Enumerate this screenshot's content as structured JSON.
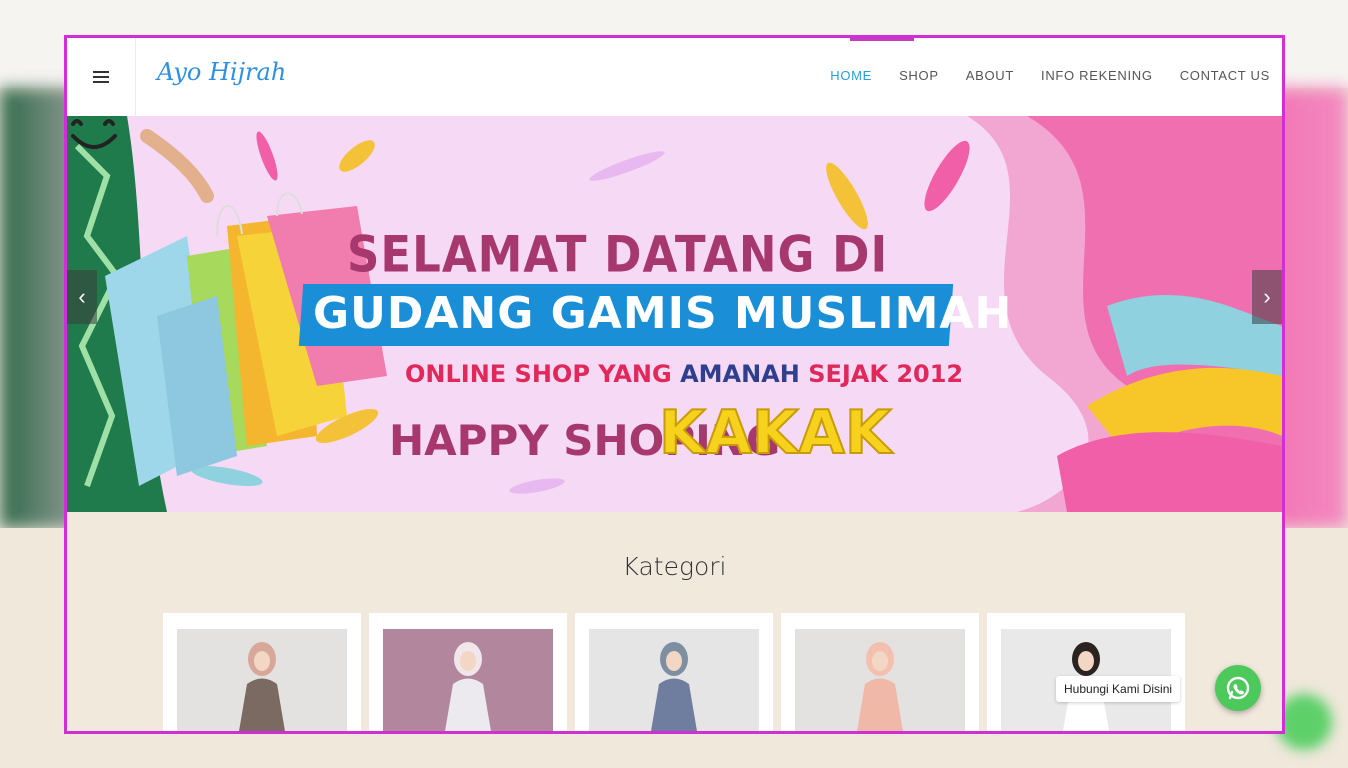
{
  "brand": {
    "name": "Ayo Hijrah"
  },
  "nav": {
    "items": [
      {
        "label": "HOME",
        "active": true
      },
      {
        "label": "SHOP",
        "active": false
      },
      {
        "label": "ABOUT",
        "active": false
      },
      {
        "label": "INFO REKENING",
        "active": false
      },
      {
        "label": "CONTACT US",
        "active": false
      }
    ]
  },
  "hero": {
    "line1": "SELAMAT DATANG DI",
    "line2": "GUDANG GAMIS MUSLIMAH",
    "line3_a": "ONLINE SHOP YANG ",
    "line3_b": "AMANAH",
    "line3_c": " SEJAK 2012",
    "line4": "HAPPY SHOPING",
    "line4_accent": "KAKAK",
    "prev_icon": "chevron-left-icon",
    "next_icon": "chevron-right-icon"
  },
  "kategori": {
    "title": "Kategori",
    "cards": [
      {
        "name": "category-1",
        "bg": "#e4e2e1",
        "garment": "#7a6a62",
        "hijab": "#d7a89a"
      },
      {
        "name": "category-2",
        "bg": "#b2869d",
        "garment": "#ece9ef",
        "hijab": "#f1e6e9"
      },
      {
        "name": "category-3",
        "bg": "#e5e5e5",
        "garment": "#6f7e9e",
        "hijab": "#7f8fa2"
      },
      {
        "name": "category-4",
        "bg": "#e4e2e1",
        "garment": "#f0b8a6",
        "hijab": "#f3bfae"
      },
      {
        "name": "category-5",
        "bg": "#e9e9e9",
        "garment": "#ffffff",
        "hijab": "#2a2320"
      }
    ]
  },
  "whatsapp": {
    "label": "Hubungi Kami Disini",
    "icon": "whatsapp-icon",
    "color": "#4cc95a"
  },
  "colors": {
    "accent": "#2a9fd6",
    "frame": "#d12fd3"
  }
}
